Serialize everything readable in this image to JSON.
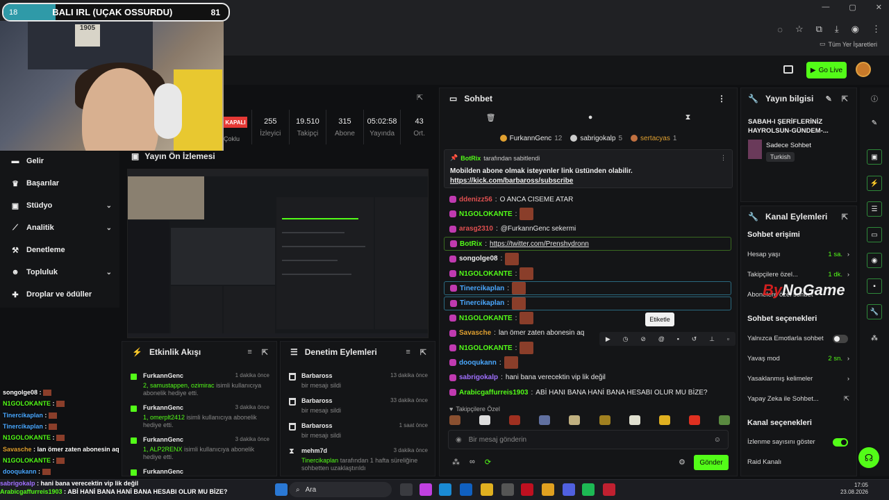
{
  "poll": {
    "left_value": "18",
    "title": "BALI IRL (UÇAK OSSURDU)",
    "right_value": "81"
  },
  "webcam": {
    "poster_text": "1905"
  },
  "browser": {
    "bookmarks_label": "Tüm Yer İşaretleri"
  },
  "header": {
    "go_live_label": "Go Live"
  },
  "stats": {
    "status_badge": "KAPALI",
    "multi_label": "Çoklu",
    "items": [
      {
        "value": "255",
        "label": "İzleyici"
      },
      {
        "value": "19.510",
        "label": "Takipçi"
      },
      {
        "value": "315",
        "label": "Abone"
      },
      {
        "value": "05:02:58",
        "label": "Yayında"
      },
      {
        "value": "43",
        "label": "Ort."
      }
    ]
  },
  "nav": {
    "items": [
      {
        "label": "Gelir",
        "icon": "wallet-icon",
        "chevron": false
      },
      {
        "label": "Başarılar",
        "icon": "trophy-icon",
        "chevron": false
      },
      {
        "label": "Stüdyo",
        "icon": "studio-icon",
        "chevron": true
      },
      {
        "label": "Analitik",
        "icon": "chart-icon",
        "chevron": true
      },
      {
        "label": "Denetleme",
        "icon": "gavel-icon",
        "chevron": false
      },
      {
        "label": "Topluluk",
        "icon": "people-icon",
        "chevron": true
      },
      {
        "label": "Droplar ve ödüller",
        "icon": "gift-icon",
        "chevron": false
      }
    ]
  },
  "preview": {
    "title": "Yayın Ön İzlemesi"
  },
  "events": {
    "title": "Etkinlik Akışı",
    "items": [
      {
        "name": "FurkannGenc",
        "time": "1 dakika önce",
        "highlight": "2, samustappen, ozimirac",
        "desc": "isimli kullanıcıya abonelik hediye etti."
      },
      {
        "name": "FurkannGenc",
        "time": "3 dakika önce",
        "highlight": "1, omerplt2412",
        "desc": "isimli kullanıcıya abonelik hediye etti."
      },
      {
        "name": "FurkannGenc",
        "time": "3 dakika önce",
        "highlight": "1, ALP2RENX",
        "desc": "isimli kullanıcıya abonelik hediye etti."
      },
      {
        "name": "FurkannGenc",
        "time": "",
        "highlight": "",
        "desc": ""
      }
    ]
  },
  "moderation": {
    "title": "Denetim Eylemleri",
    "items": [
      {
        "name": "Barbaross",
        "time": "13 dakika önce",
        "desc": "bir mesajı sildi"
      },
      {
        "name": "Barbaross",
        "time": "33 dakika önce",
        "desc": "bir mesajı sildi"
      },
      {
        "name": "Barbaross",
        "time": "1 saat önce",
        "desc": "bir mesajı sildi"
      },
      {
        "name": "mehm7d",
        "time": "3 dakika önce",
        "highlight": "Tinercikaplan",
        "desc": "tarafından 1 hafta süreliğine sohbetten uzaklaştırıldı"
      }
    ]
  },
  "chat": {
    "title": "Sohbet",
    "top_gifters": [
      {
        "name": "FurkannGenc",
        "count": "12"
      },
      {
        "name": "sabrigokalp",
        "count": "5"
      },
      {
        "name": "sertacyas",
        "count": "1"
      }
    ],
    "pinned": {
      "by": "BotRix",
      "suffix": "tarafından sabitlendi",
      "text": "Mobilden abone olmak isteyenler link üstünden olabilir.",
      "link": "https://kick.com/barbaross/subscribe"
    },
    "messages": [
      {
        "user": "ddenizz56",
        "color": "#e05050",
        "text": "O ANCA CISEME ATAR"
      },
      {
        "user": "N1GOLOKANTE",
        "color": "#53fc18",
        "text": ""
      },
      {
        "user": "arasg2310",
        "color": "#e05050",
        "text": "@FurkannGenc sekermi"
      },
      {
        "user": "BotRix",
        "color": "#53fc18",
        "text": "https://twitter.com/Prenshydronn"
      },
      {
        "user": "songolge08",
        "color": "#eeeeee",
        "text": ""
      },
      {
        "user": "N1GOLOKANTE",
        "color": "#53fc18",
        "text": ""
      },
      {
        "user": "Tinercikaplan",
        "color": "#4aa8ff",
        "text": ""
      },
      {
        "user": "Tinercikaplan",
        "color": "#4aa8ff",
        "text": ""
      },
      {
        "user": "N1GOLOKANTE",
        "color": "#53fc18",
        "text": ""
      },
      {
        "user": "Savasche",
        "color": "#e0a030",
        "text": "lan ömer zaten abonesin aq"
      },
      {
        "user": "N1GOLOKANTE",
        "color": "#53fc18",
        "text": ""
      },
      {
        "user": "dooqukann",
        "color": "#4aa8ff",
        "text": ""
      },
      {
        "user": "sabrigokalp",
        "color": "#a070ff",
        "text": "hani bana verecektin vip lik değil"
      },
      {
        "user": "Arabicgaffurreis1903",
        "color": "#53fc18",
        "text": "ABİ HANI BANA HANİ BANA HESABI OLUR MU BİZE?"
      }
    ],
    "tooltip": "Etiketle",
    "sub_only_label": "Takipçilere Özel",
    "input_placeholder": "Bir mesaj gönderin",
    "send_label": "Gönder"
  },
  "stream_info": {
    "title": "Yayın bilgisi",
    "stream_title": "SABAH-I ŞERİFLERİNİZ HAYROLSUN-GÜNDEM-...",
    "category": "Sadece Sohbet",
    "tag": "Turkish"
  },
  "channel_actions": {
    "title": "Kanal Eylemleri",
    "chat_access": "Sohbet erişimi",
    "rows_access": [
      {
        "label": "Hesap yaşı",
        "value": "1 sa."
      },
      {
        "label": "Takipçilere özel...",
        "value": "1 dk."
      },
      {
        "label": "Abonelere özel sohbet",
        "value": ""
      }
    ],
    "chat_options": "Sohbet seçenekleri",
    "rows_options": [
      {
        "label": "Yalnızca Emotlarla sohbet",
        "value": ""
      },
      {
        "label": "Yavaş mod",
        "value": "2 sn."
      },
      {
        "label": "Yasaklanmış kelimeler",
        "value": ""
      },
      {
        "label": "Yapay Zeka ile Sohbet...",
        "value": ""
      }
    ],
    "channel_options": "Kanal seçenekleri",
    "rows_channel": [
      {
        "label": "İzlenme sayısını göster",
        "value": ""
      },
      {
        "label": "Raid Kanalı",
        "value": ""
      }
    ]
  },
  "watermark": {
    "brand_a": "By",
    "brand_b": "NoGame"
  },
  "overlay_chat": [
    {
      "user": "songolge08",
      "text": ""
    },
    {
      "user": "N1GOLOKANTE",
      "text": ""
    },
    {
      "user": "Tinercikaplan",
      "text": ""
    },
    {
      "user": "Tinercikaplan",
      "text": ""
    },
    {
      "user": "N1GOLOKANTE",
      "text": ""
    },
    {
      "user": "Savasche",
      "text": "lan ömer zaten abonesin aq"
    },
    {
      "user": "N1GOLOKANTE",
      "text": ""
    },
    {
      "user": "dooqukann",
      "text": ""
    }
  ],
  "overlay_bottom": {
    "line1_user": "sabrigokalp",
    "line1_text": "hani bana verecektin vip lik değil",
    "line2_user": "Arabicgaffurreis1903",
    "line2_text": "ABİ HANİ BANA HANİ BANA HESABI OLUR MU BİZE?"
  },
  "taskbar": {
    "search_label": "Ara",
    "time": "17:05",
    "date": "23.08.2026"
  }
}
